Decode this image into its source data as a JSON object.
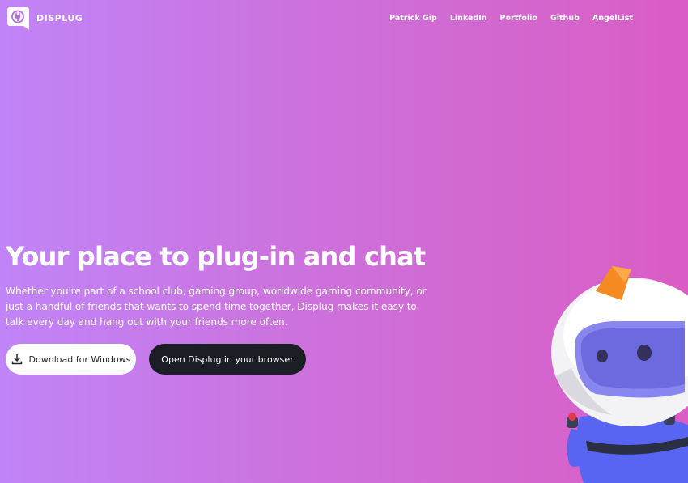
{
  "header": {
    "brand": "DISPLUG",
    "logo_icon": "plug-icon",
    "nav": [
      {
        "label": "Patrick Gip"
      },
      {
        "label": "LinkedIn"
      },
      {
        "label": "Portfolio"
      },
      {
        "label": "Github"
      },
      {
        "label": "AngelList"
      }
    ]
  },
  "hero": {
    "title": "Your place to plug-in and chat",
    "description": "Whether you're part of a school club, gaming group, worldwide gaming community, or just a handful of friends that wants to spend time together, Displug makes it easy to talk every day and hang out with your friends more often.",
    "download_button": {
      "label": "Download for Windows",
      "icon": "download-icon"
    },
    "browser_button": {
      "label": "Open Displug in your browser"
    }
  },
  "colors": {
    "gradient_start": "#c084f8",
    "gradient_end": "#d95dc4",
    "dark_button": "#1b1e25"
  }
}
